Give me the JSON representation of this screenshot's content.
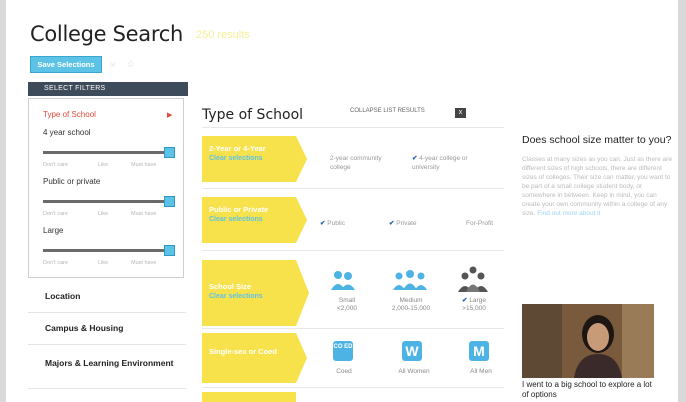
{
  "header": {
    "title": "College Search",
    "results": "250 results",
    "save_button": "Save Selections"
  },
  "sidebar": {
    "select_filters": "SELECT FILTERS",
    "active_filter": "Type of School",
    "filters": [
      {
        "label": "4 year school",
        "ticks": [
          "Don't care",
          "Like",
          "Must have"
        ],
        "value": 1.0
      },
      {
        "label": "Public or private",
        "ticks": [
          "Don't care",
          "Like",
          "Must have"
        ],
        "value": 1.0
      },
      {
        "label": "Large",
        "ticks": [
          "Don't care",
          "Like",
          "Must have"
        ],
        "value": 1.0
      }
    ],
    "nav": [
      "Location",
      "Campus & Housing",
      "Majors & Learning Environment"
    ]
  },
  "main": {
    "title": "Type of School",
    "collapse_label": "COLLAPSE LIST RESULTS",
    "collapse_x": "x",
    "clear": "Clear selections",
    "rows": [
      {
        "label": "2-Year or 4-Year",
        "options": [
          {
            "text": "2-year community college",
            "checked": false
          },
          {
            "text": "4-year college or university",
            "checked": true
          }
        ]
      },
      {
        "label": "Public or Private",
        "options": [
          {
            "text": "Public",
            "checked": true
          },
          {
            "text": "Private",
            "checked": true
          },
          {
            "text": "For-Profit",
            "checked": false
          }
        ]
      },
      {
        "label": "School Size",
        "options": [
          {
            "text": "Small",
            "sub": "<2,000",
            "checked": false
          },
          {
            "text": "Medium",
            "sub": "2,000-15,000",
            "checked": false
          },
          {
            "text": "Large",
            "sub": ">15,000",
            "checked": true
          }
        ]
      },
      {
        "label": "Single-sex or Coed",
        "options": [
          {
            "text": "Coed",
            "icon": "CO ED"
          },
          {
            "text": "All Women",
            "icon": "W"
          },
          {
            "text": "All Men",
            "icon": "M"
          }
        ]
      }
    ]
  },
  "side": {
    "heading": "Does school size matter to you?",
    "body": "Classes at many sizes as you can. Just as there are different sizes of high schools, there are different sizes of colleges. Their size can matter, you want to be part of a small college student body, or somewhere in between. Keep in mind, you can create your own community within a college of any size.",
    "link": "Find out more about it",
    "caption": "I went to a big school to explore a lot of options"
  },
  "colors": {
    "accent": "#5cc3e6",
    "band": "#f8e24c",
    "active": "#e14a3b",
    "check": "#1f5fb8"
  }
}
